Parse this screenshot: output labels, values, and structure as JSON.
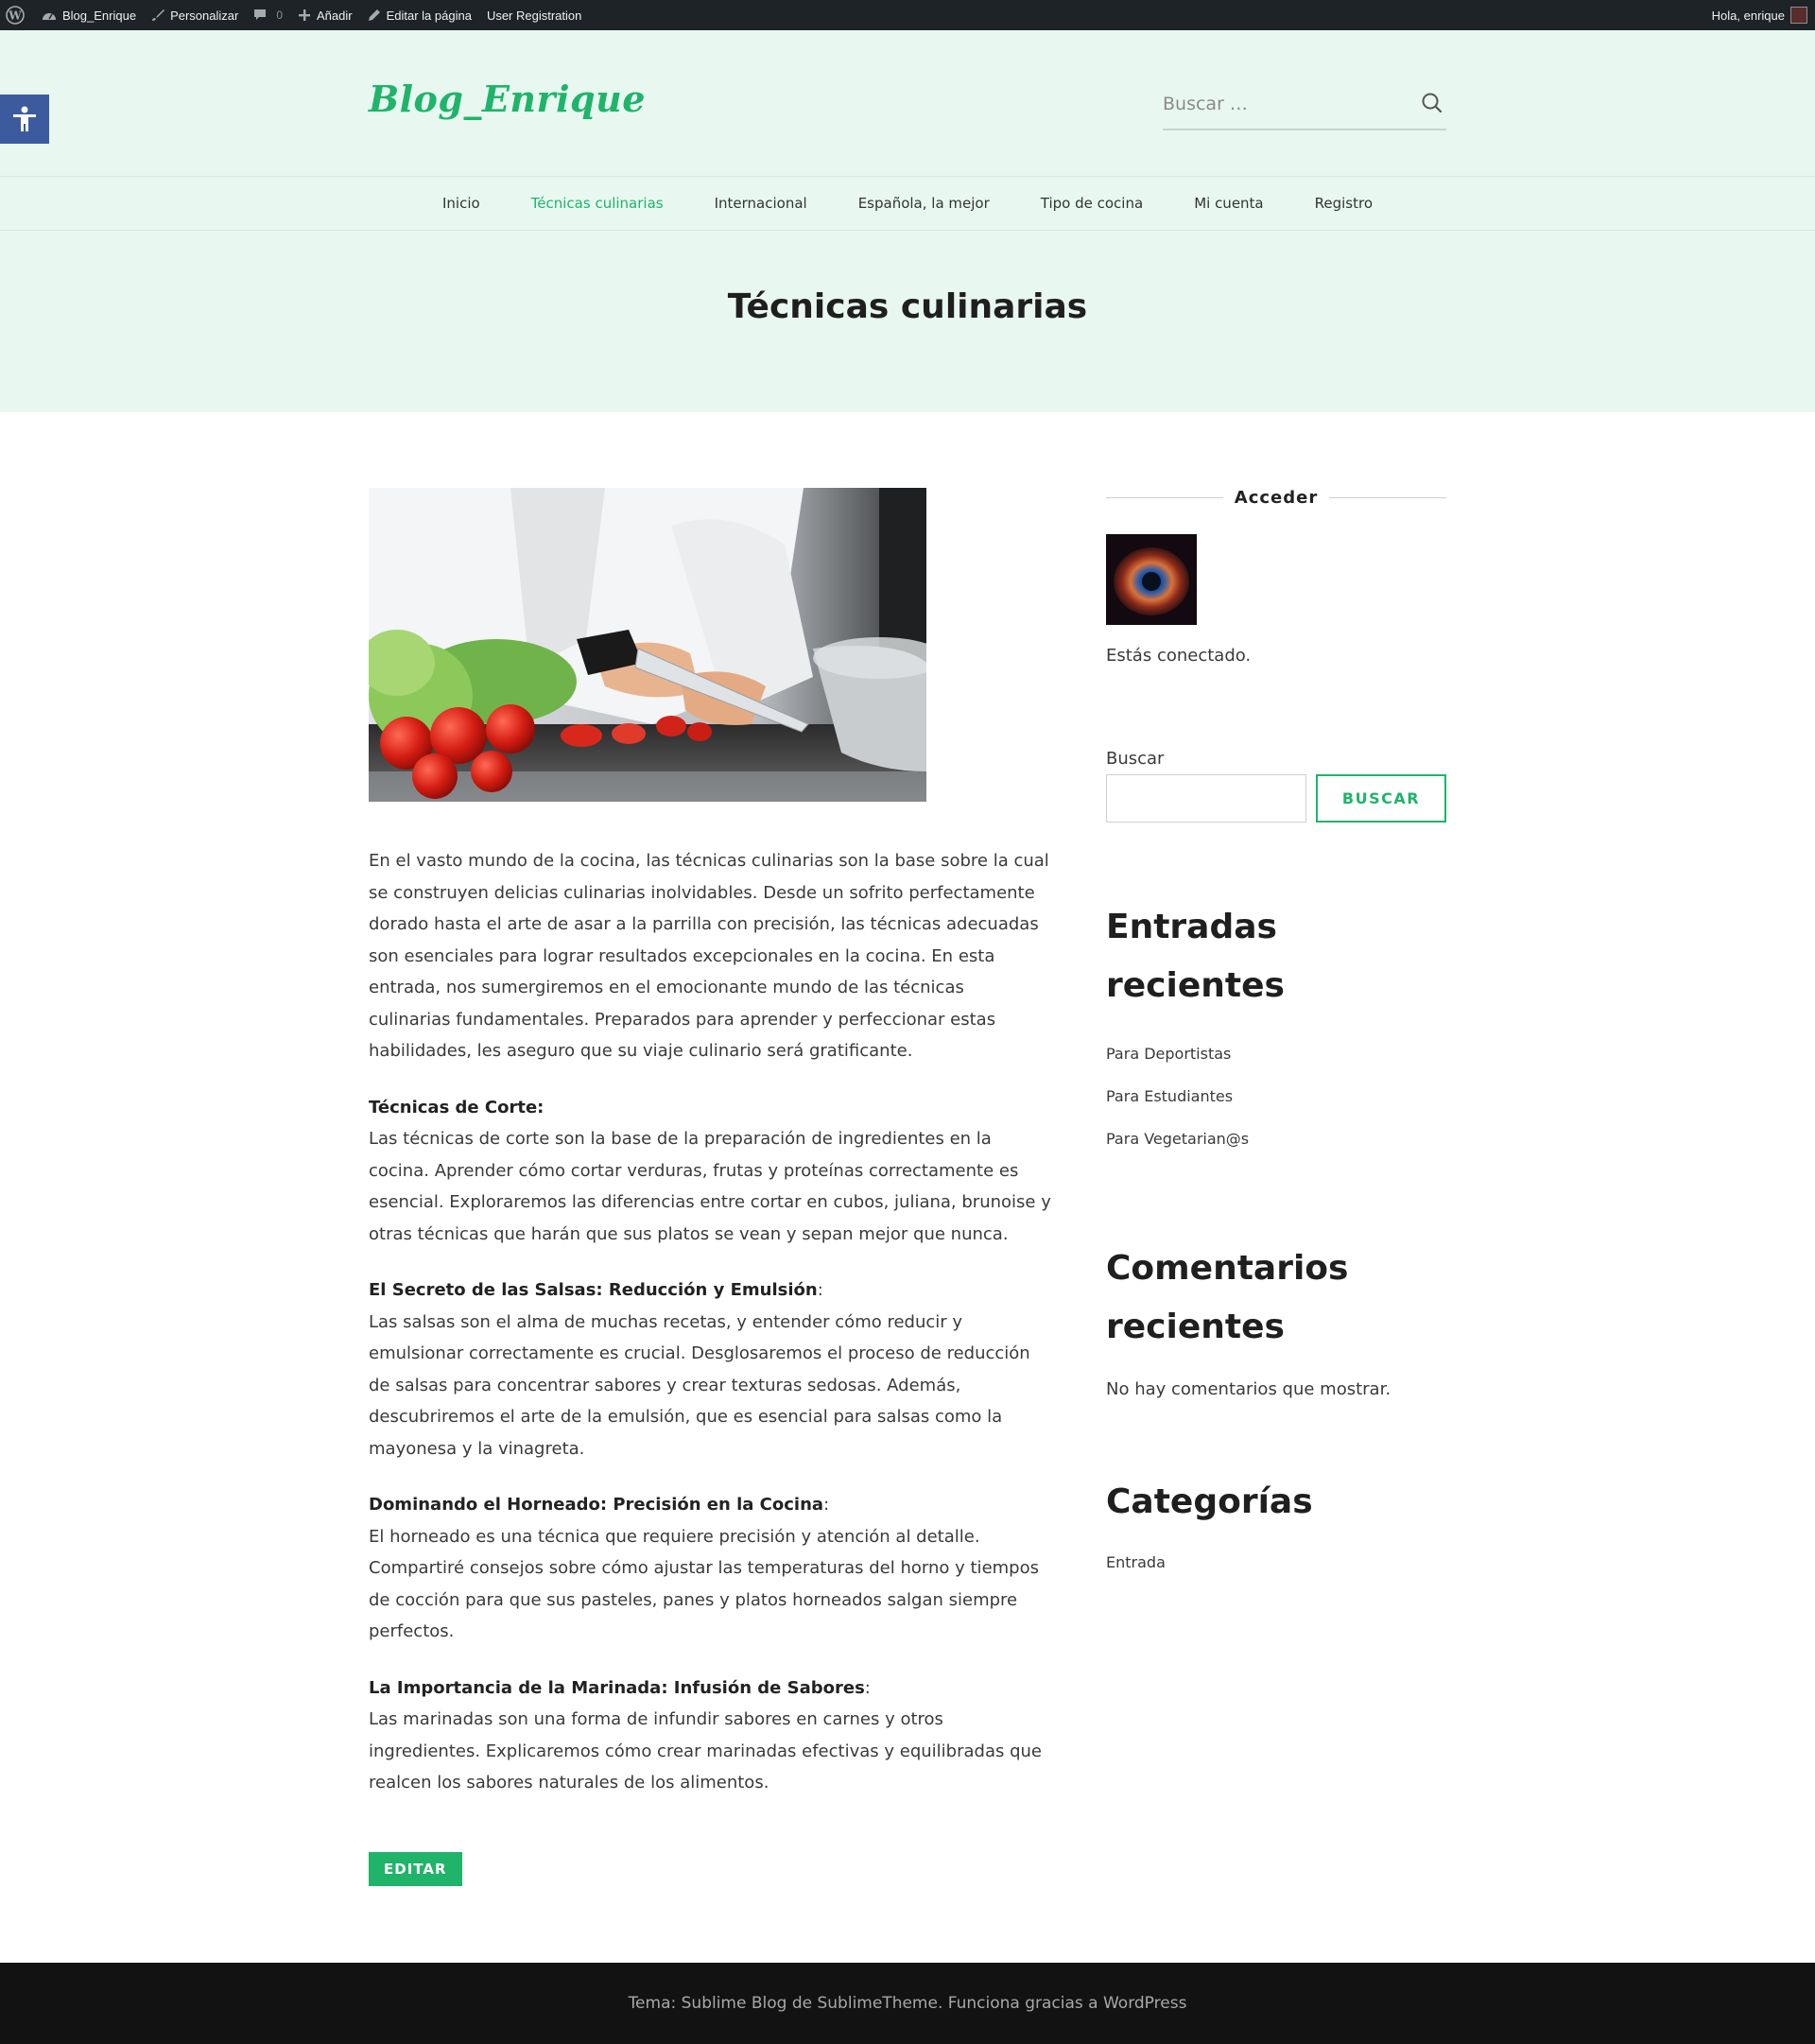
{
  "admin_bar": {
    "site_name": "Blog_Enrique",
    "customize": "Personalizar",
    "comments_count": "0",
    "add_new": "Añadir",
    "edit_page": "Editar la página",
    "user_registration": "User Registration",
    "greeting": "Hola, enrique"
  },
  "header": {
    "logo": "Blog_Enrique",
    "search_placeholder": "Buscar …",
    "nav": [
      {
        "label": "Inicio"
      },
      {
        "label": "Técnicas culinarias"
      },
      {
        "label": "Internacional"
      },
      {
        "label": "Española, la mejor"
      },
      {
        "label": "Tipo de cocina"
      },
      {
        "label": "Mi cuenta"
      },
      {
        "label": "Registro"
      }
    ],
    "active_nav": "Técnicas culinarias",
    "page_title": "Técnicas culinarias"
  },
  "article": {
    "intro": "En el vasto mundo de la cocina, las técnicas culinarias son la base sobre la cual se construyen delicias culinarias inolvidables. Desde un sofrito perfectamente dorado hasta el arte de asar a la parrilla con precisión, las técnicas adecuadas son esenciales para lograr resultados excepcionales en la cocina. En esta entrada, nos sumergiremos en el emocionante mundo de las técnicas culinarias fundamentales. Preparados para aprender y perfeccionar estas habilidades, les aseguro que su viaje culinario será gratificante.",
    "sections": [
      {
        "title": "Técnicas de Corte:",
        "suffix": "",
        "body": "Las técnicas de corte son la base de la preparación de ingredientes en la cocina. Aprender cómo cortar verduras, frutas y proteínas correctamente es esencial. Exploraremos las diferencias entre cortar en cubos, juliana, brunoise y otras técnicas que harán que sus platos se vean y sepan mejor que nunca."
      },
      {
        "title": "El Secreto de las Salsas: Reducción y Emulsión",
        "suffix": ":",
        "body": "Las salsas son el alma de muchas recetas, y entender cómo reducir y emulsionar correctamente es crucial. Desglosaremos el proceso de reducción de salsas para concentrar sabores y crear texturas sedosas. Además, descubriremos el arte de la emulsión, que es esencial para salsas como la mayonesa y la vinagreta."
      },
      {
        "title": "Dominando el Horneado: Precisión en la Cocina",
        "suffix": ":",
        "body": "El horneado es una técnica que requiere precisión y atención al detalle. Compartiré consejos sobre cómo ajustar las temperaturas del horno y tiempos de cocción para que sus pasteles, panes y platos horneados salgan siempre perfectos."
      },
      {
        "title": "La Importancia de la Marinada: Infusión de Sabores",
        "suffix": ":",
        "body": "Las marinadas son una forma de infundir sabores en carnes y otros ingredientes. Explicaremos cómo crear marinadas efectivas y equilibradas que realcen los sabores naturales de los alimentos."
      }
    ],
    "edit_button": "EDITAR"
  },
  "sidebar": {
    "login_title": "Acceder",
    "connected_text": "Estás conectado.",
    "search_label": "Buscar",
    "search_button": "BUSCAR",
    "recent_posts_title": "Entradas recientes",
    "recent_posts": [
      "Para Deportistas",
      "Para Estudiantes",
      "Para Vegetarian@s"
    ],
    "recent_comments_title": "Comentarios recientes",
    "no_comments": "No hay comentarios que mostrar.",
    "categories_title": "Categorías",
    "categories": [
      "Entrada"
    ]
  },
  "footer": {
    "text": "Tema: Sublime Blog de SublimeTheme. Funciona gracias a WordPress"
  },
  "colors": {
    "accent": "#1fb46a",
    "header_bg": "#e8f8f1",
    "admin_bar": "#1d2327",
    "footer_bg": "#121212",
    "a11y_button": "#3c5a9e"
  }
}
